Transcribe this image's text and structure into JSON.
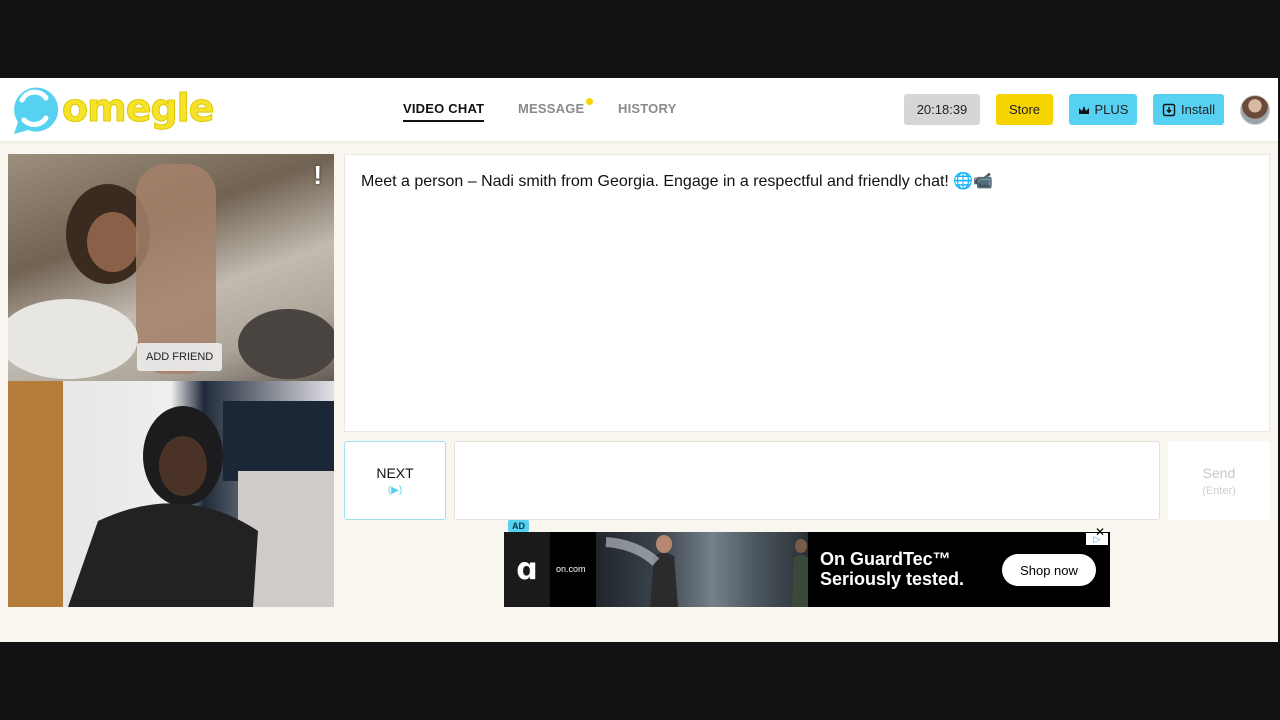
{
  "header": {
    "logo_text": "omegle",
    "nav": [
      {
        "label": "VIDEO CHAT",
        "active": true
      },
      {
        "label": "MESSAGE",
        "active": false,
        "notification": true
      },
      {
        "label": "HISTORY",
        "active": false
      }
    ],
    "clock": "20:18:39",
    "store_label": "Store",
    "plus_label": "PLUS",
    "install_label": "Install"
  },
  "video": {
    "add_friend_label": "ADD FRIEND",
    "report_glyph": "!"
  },
  "chat": {
    "message": "Meet a person – Nadi smith from Georgia. Engage in a respectful and friendly chat! 🌐📹",
    "next_label": "NEXT",
    "next_hint": "(▶)",
    "send_label": "Send",
    "send_hint": "(Enter)",
    "input_value": ""
  },
  "ad": {
    "tag": "AD",
    "domain": "on.com",
    "headline_line1": "On GuardTec™",
    "headline_line2": "Seriously tested.",
    "cta": "Shop now",
    "close": "✕"
  },
  "colors": {
    "brand_yellow": "#f5d400",
    "brand_cyan": "#57d1f2",
    "background": "#f9f6f0"
  }
}
